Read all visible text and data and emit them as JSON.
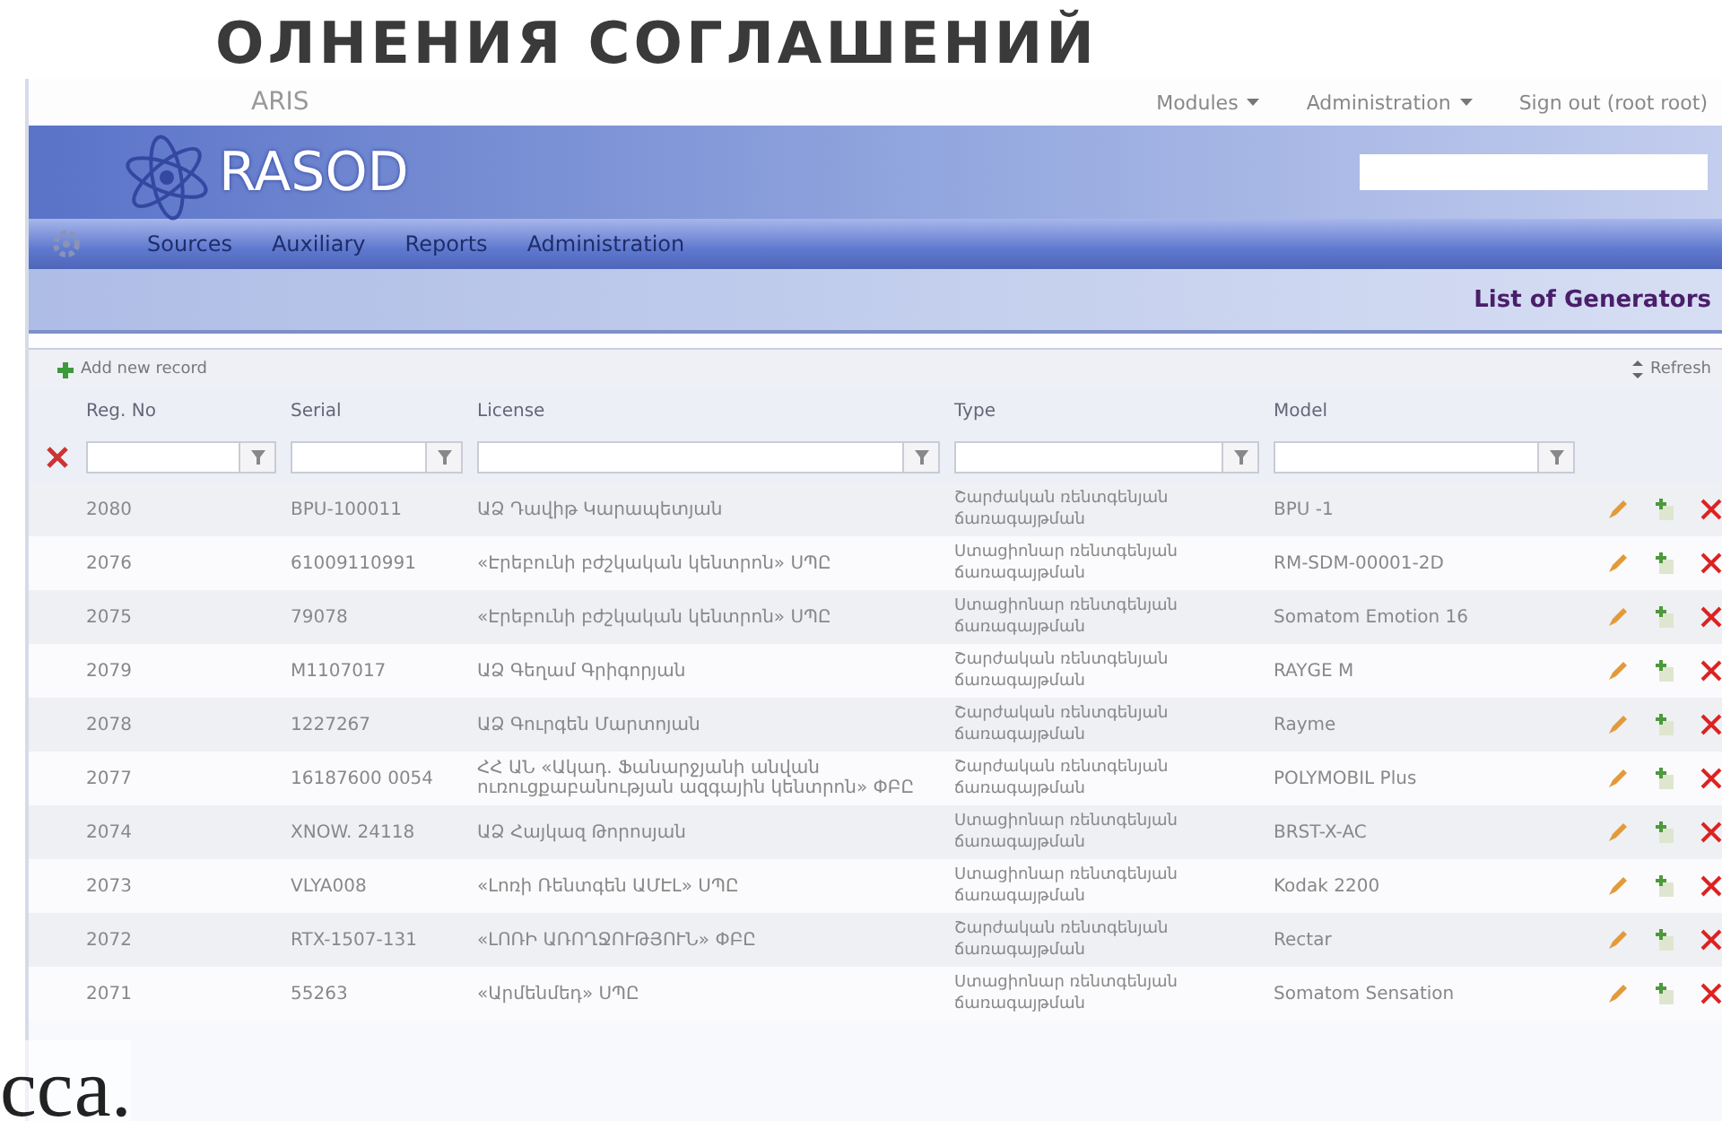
{
  "slide": {
    "heading_fragment": "ОЛНЕНИЯ СОГЛАШЕНИЙ",
    "footer_fragment": "сса."
  },
  "app": {
    "brand_small": "ARIS",
    "top_menu": [
      {
        "label": "Modules",
        "has_menu": true
      },
      {
        "label": "Administration",
        "has_menu": true
      },
      {
        "label": "Sign out  (root root)",
        "has_menu": false
      }
    ],
    "title": "RASOD",
    "nav": [
      "Sources",
      "Auxiliary",
      "Reports",
      "Administration"
    ],
    "page_title": "List of Generators",
    "toolbar": {
      "add": "Add new record",
      "refresh": "Refresh"
    },
    "table": {
      "columns": [
        "Reg. No",
        "Serial",
        "License",
        "Type",
        "Model"
      ],
      "rows": [
        {
          "cells": [
            "2080",
            "BPU-100011",
            "ԱՁ Դավիթ Կարապետյան",
            "Շարժական ռենտգենյան ճառագայթման",
            "BPU -1"
          ]
        },
        {
          "cells": [
            "2076",
            "61009110991",
            "«Էրեբունի բժշկական կենտրոն» ՍՊԸ",
            "Ստացիոնար ռենտգենյան ճառագայթման",
            "RM-SDM-00001-2D"
          ]
        },
        {
          "cells": [
            "2075",
            "79078",
            "«Էրեբունի բժշկական կենտրոն» ՍՊԸ",
            "Ստացիոնար ռենտգենյան ճառագայթման",
            "Somatom Emotion 16"
          ]
        },
        {
          "cells": [
            "2079",
            "M1107017",
            "ԱՁ Գեղամ Գրիգորյան",
            "Շարժական ռենտգենյան ճառագայթման",
            "RAYGE M"
          ]
        },
        {
          "cells": [
            "2078",
            "1227267",
            "ԱՁ Գուրգեն Մարտոյան",
            "Շարժական ռենտգենյան ճառագայթման",
            "Rayme"
          ]
        },
        {
          "cells": [
            "2077",
            "16187600 0054",
            "ՀՀ ԱՆ «Ակադ. Ֆանարջյանի անվան ուռուցքաբանության ազգային կենտրոն» ՓԲԸ",
            "Շարժական ռենտգենյան ճառագայթման",
            "POLYMOBIL Plus"
          ]
        },
        {
          "cells": [
            "2074",
            "XNOW. 24118",
            "ԱՁ Հայկազ Թորոսյան",
            "Ստացիոնար ռենտգենյան ճառագայթման",
            "BRST-X-AC"
          ]
        },
        {
          "cells": [
            "2073",
            "VLYA008",
            "«Լոռի Ռենտգեն ԱՄԷԼ» ՍՊԸ",
            "Ստացիոնար ռենտգենյան ճառագայթման",
            "Kodak 2200"
          ]
        },
        {
          "cells": [
            "2072",
            "RTX-1507-131",
            "«ԼՈՌԻ ԱՌՈՂՋՈՒԹՅՈՒՆ» ՓԲԸ",
            "Շարժական ռենտգենյան ճառագայթման",
            "Rectar"
          ]
        },
        {
          "cells": [
            "2071",
            "55263",
            "«Արմենմեդ» ՍՊԸ",
            "Ստացիոնար ռենտգենյան ճառագայթման",
            "Somatom Sensation"
          ]
        }
      ]
    }
  }
}
